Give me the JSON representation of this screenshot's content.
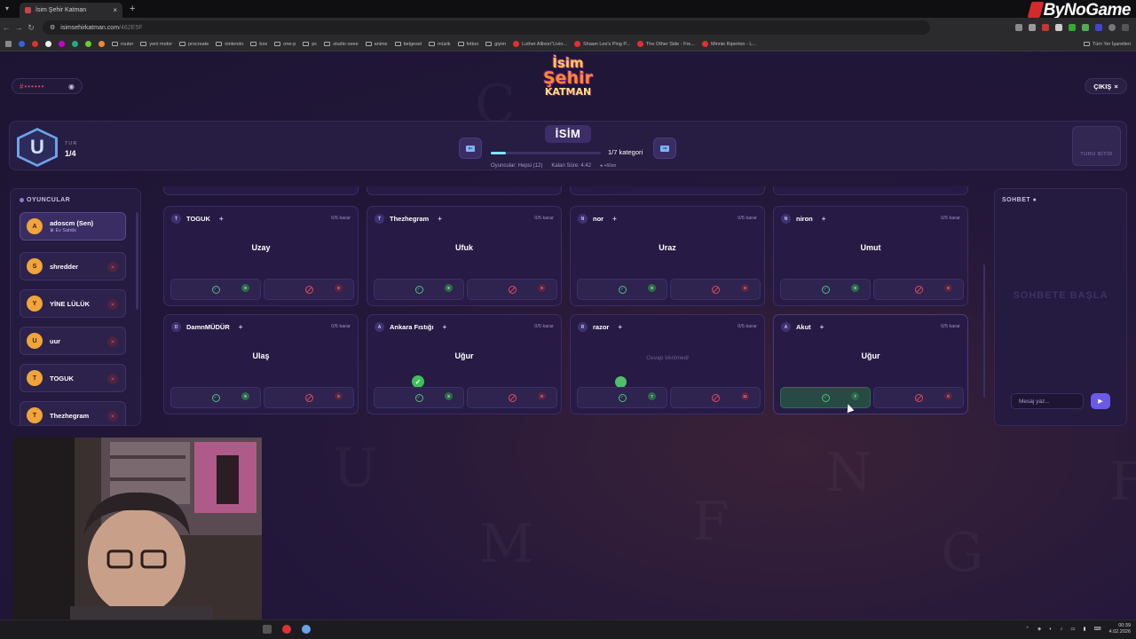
{
  "browser": {
    "tab_title": "İsim Şehir Katman",
    "url_host": "isimsehirkatman.com",
    "url_path": "/462E5F",
    "brand": "ByNoGame",
    "bookmarks": [
      "router",
      "yeni motor",
      "procreate",
      "nintendo",
      "box",
      "one-p",
      "pc",
      "studio oeee",
      "anime",
      "belgesel",
      "müzik",
      "fottoo",
      "giyim",
      "Luther Allison\"Livin...",
      "Shawn Lee's Ping P...",
      "The Other Side - Fre...",
      "Minnie Riperton - L..."
    ],
    "all_bookmarks": "Tüm Yer İşaretleri"
  },
  "header": {
    "room_code": "#••••••",
    "logo_line1": "İsim",
    "logo_line2": "Şehir",
    "logo_line3": "KATMAN",
    "exit_label": "ÇIKIŞ"
  },
  "round": {
    "badge_letter": "U",
    "tur_label": "TUR",
    "tur_value": "1/4",
    "category": "İSİM",
    "category_progress": "1/7 kategori",
    "progress_fraction": 0.14,
    "players_info": "Oyuncular: Hepsi (12)",
    "time_left": "Kalan Süre: 4:42",
    "bonus": "+60sn",
    "end_round_label": "TURU BİTİR"
  },
  "players": {
    "title": "OYUNCULAR",
    "list": [
      {
        "initial": "A",
        "name": "adoscm (Sen)",
        "sub": "Ev Sahibi"
      },
      {
        "initial": "S",
        "name": "shredder"
      },
      {
        "initial": "Y",
        "name": "YİNE LÜLÜK"
      },
      {
        "initial": "U",
        "name": "uur"
      },
      {
        "initial": "T",
        "name": "TOGUK"
      },
      {
        "initial": "T",
        "name": "Thezhegram"
      }
    ]
  },
  "answers": {
    "votes_label": "0/5 karar",
    "empty_answer": "Cevap Verilmedi",
    "cards": [
      {
        "initial": "T",
        "name": "TOGUK",
        "answer": "Uzay",
        "ok": "9",
        "no": "0"
      },
      {
        "initial": "T",
        "name": "Thezhegram",
        "answer": "Ufuk",
        "ok": "9",
        "no": "0"
      },
      {
        "initial": "N",
        "name": "nor",
        "answer": "Uraz",
        "ok": "9",
        "no": "0"
      },
      {
        "initial": "N",
        "name": "niron",
        "answer": "Umut",
        "ok": "9",
        "no": "0"
      },
      {
        "initial": "D",
        "name": "DamnMÜDÜR",
        "answer": "Ulaş",
        "ok": "9",
        "no": "0"
      },
      {
        "initial": "A",
        "name": "Ankara Fıstığı",
        "answer": "Uğur",
        "ok": "8",
        "no": "0"
      },
      {
        "initial": "R",
        "name": "razor",
        "answer": "",
        "ok": "7",
        "no": "11"
      },
      {
        "initial": "A",
        "name": "Akut",
        "answer": "Uğur",
        "ok": "7",
        "no": "0"
      }
    ]
  },
  "chat": {
    "title": "SOHBET",
    "empty_text": "SOHBETE BAŞLA",
    "placeholder": "Mesaj yaz..."
  },
  "taskbar": {
    "time": "00:39",
    "date": "4.02.2026"
  }
}
